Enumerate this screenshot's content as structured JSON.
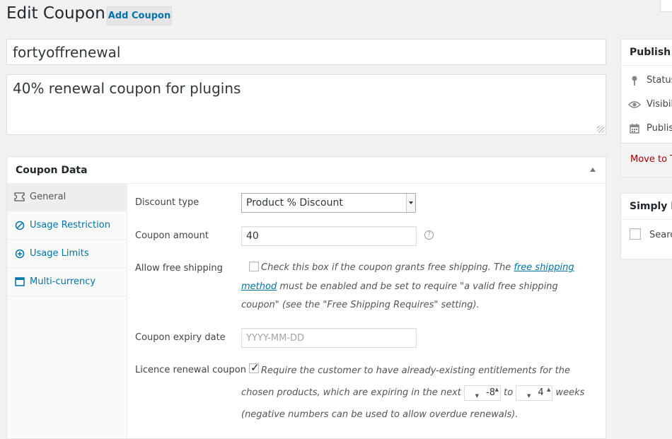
{
  "header": {
    "title": "Edit Coupon",
    "add_button": "Add Coupon"
  },
  "coupon": {
    "code": "fortyoffrenewal",
    "description": "40% renewal coupon for plugins"
  },
  "coupon_data": {
    "title": "Coupon Data",
    "tabs": [
      {
        "label": "General",
        "icon": "ticket-icon",
        "active": true
      },
      {
        "label": "Usage Restriction",
        "icon": "ban-icon",
        "active": false
      },
      {
        "label": "Usage Limits",
        "icon": "plus-circle-icon",
        "active": false
      },
      {
        "label": "Multi-currency",
        "icon": "window-icon",
        "active": false
      }
    ],
    "fields": {
      "discount_type": {
        "label": "Discount type",
        "value": "Product % Discount"
      },
      "coupon_amount": {
        "label": "Coupon amount",
        "value": "40",
        "help_glyph": "?"
      },
      "free_shipping": {
        "label": "Allow free shipping",
        "checked": false,
        "desc_before": "Check this box if the coupon grants free shipping. The ",
        "desc_link": "free shipping method",
        "desc_after": " must be enabled and be set to require \"a valid free shipping coupon\" (see the \"Free Shipping Requires\" setting)."
      },
      "expiry_date": {
        "label": "Coupon expiry date",
        "placeholder": "YYYY-MM-DD"
      },
      "licence_renewal": {
        "label": "Licence renewal coupon",
        "checked": true,
        "desc_part1": "Require the customer to have already-existing entitlements for the chosen products, which are expiring in the next ",
        "from_value": "-8",
        "to_word": " to ",
        "to_value": "4",
        "desc_part2": " weeks (negative numbers can be used to allow overdue renewals)."
      }
    }
  },
  "sidebar": {
    "publish": {
      "title": "Publish",
      "status_label": "Status",
      "visibility_label": "Visibili",
      "publish_label": "Publis",
      "trash_link": "Move to T"
    },
    "simply": {
      "title": "Simply Ex",
      "checkbox_label": "Searc"
    }
  },
  "colors": {
    "link": "#0073aa",
    "trash": "#a00000",
    "background": "#f1f1f1"
  }
}
